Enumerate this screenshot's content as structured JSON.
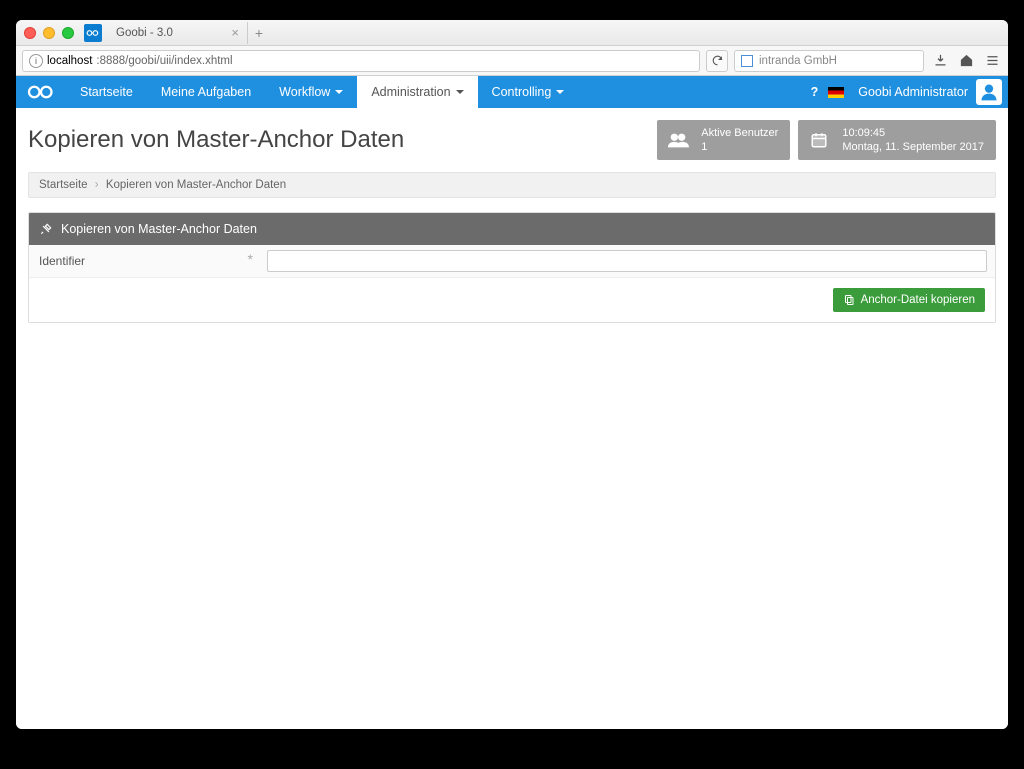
{
  "browser": {
    "tab_title": "Goobi - 3.0",
    "url_host": "localhost",
    "url_path": ":8888/goobi/uii/index.xhtml",
    "search_placeholder": "intranda GmbH"
  },
  "nav": {
    "items": [
      "Startseite",
      "Meine Aufgaben",
      "Workflow",
      "Administration",
      "Controlling"
    ],
    "user": "Goobi Administrator"
  },
  "header": {
    "title": "Kopieren von Master-Anchor Daten",
    "active_users_label": "Aktive Benutzer",
    "active_users_count": "1",
    "time": "10:09:45",
    "date": "Montag, 11. September 2017"
  },
  "breadcrumb": {
    "root": "Startseite",
    "current": "Kopieren von Master-Anchor Daten"
  },
  "panel": {
    "title": "Kopieren von Master-Anchor Daten",
    "field_label": "Identifier",
    "button_label": "Anchor-Datei kopieren"
  }
}
